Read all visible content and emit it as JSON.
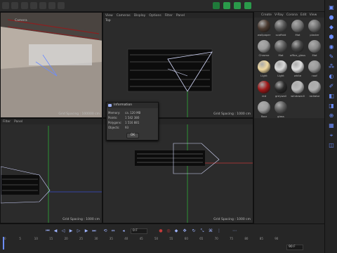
{
  "top_viewport_menu": [
    "View",
    "Cameras",
    "Display",
    "Options",
    "Filter",
    "Panel"
  ],
  "viewport_tl": {
    "camera_label": "Camera",
    "grid_spacing": "Grid Spacing : 100000 cm"
  },
  "viewport_tr": {
    "name": "Top",
    "grid_spacing": "Grid Spacing : 1000 cm"
  },
  "viewport_bl": {
    "menu": [
      "Filter",
      "Panel"
    ],
    "grid_spacing": "Grid Spacing : 1000 cm"
  },
  "viewport_br": {
    "grid_spacing": "Grid Spacing : 1000 cm"
  },
  "materials_menu": [
    "Create",
    "V-Ray",
    "Corona",
    "Edit",
    "View"
  ],
  "materials": [
    {
      "name": "wallpaper",
      "color": "#4a3a30"
    },
    {
      "name": "scaffold",
      "color": "#555555"
    },
    {
      "name": "Mat",
      "color": "#777777"
    },
    {
      "name": "plaster",
      "color": "#6e6e6e"
    },
    {
      "name": "Chrome",
      "color": "#9a9a9a"
    },
    {
      "name": "Mat",
      "color": "#5a5a5a"
    },
    {
      "name": "office_glass",
      "color": "#444444"
    },
    {
      "name": "Mat",
      "color": "#888888"
    },
    {
      "name": "Light",
      "color": "#f0d9a0"
    },
    {
      "name": "Light",
      "color": "#d9d9d9"
    },
    {
      "name": "white",
      "color": "#e0e0e0"
    },
    {
      "name": "roof",
      "color": "#9a9a9a"
    },
    {
      "name": "red",
      "color": "#a01818"
    },
    {
      "name": "greywall",
      "color": "#2a2a2a"
    },
    {
      "name": "windowsill",
      "color": "#bdbdbd"
    },
    {
      "name": "radiator",
      "color": "#b0b0b0"
    },
    {
      "name": "floor",
      "color": "#9c9c9c"
    },
    {
      "name": "glass",
      "color": "#5a5a5a"
    }
  ],
  "info_dialog": {
    "title": "Information",
    "rows": [
      {
        "k": "Memory:",
        "v": "ca. 120 MB"
      },
      {
        "k": "Points:",
        "v": "1 542 380"
      },
      {
        "k": "Polygons:",
        "v": "1 516 881"
      },
      {
        "k": "Objects:",
        "v": "93"
      }
    ],
    "ok_label": "OK"
  },
  "timeline": {
    "frame_field": "0 F",
    "ticks": [
      "0",
      "5",
      "10",
      "15",
      "20",
      "25",
      "30",
      "35",
      "40",
      "45",
      "50",
      "55",
      "60",
      "65",
      "70",
      "75",
      "80",
      "85",
      "90"
    ],
    "end_field": "90 F"
  },
  "colors": {
    "x_axis": "#c23a3a",
    "y_axis": "#2faa3a",
    "selection": "#6b8cff",
    "wire": "#d0d0d0"
  }
}
